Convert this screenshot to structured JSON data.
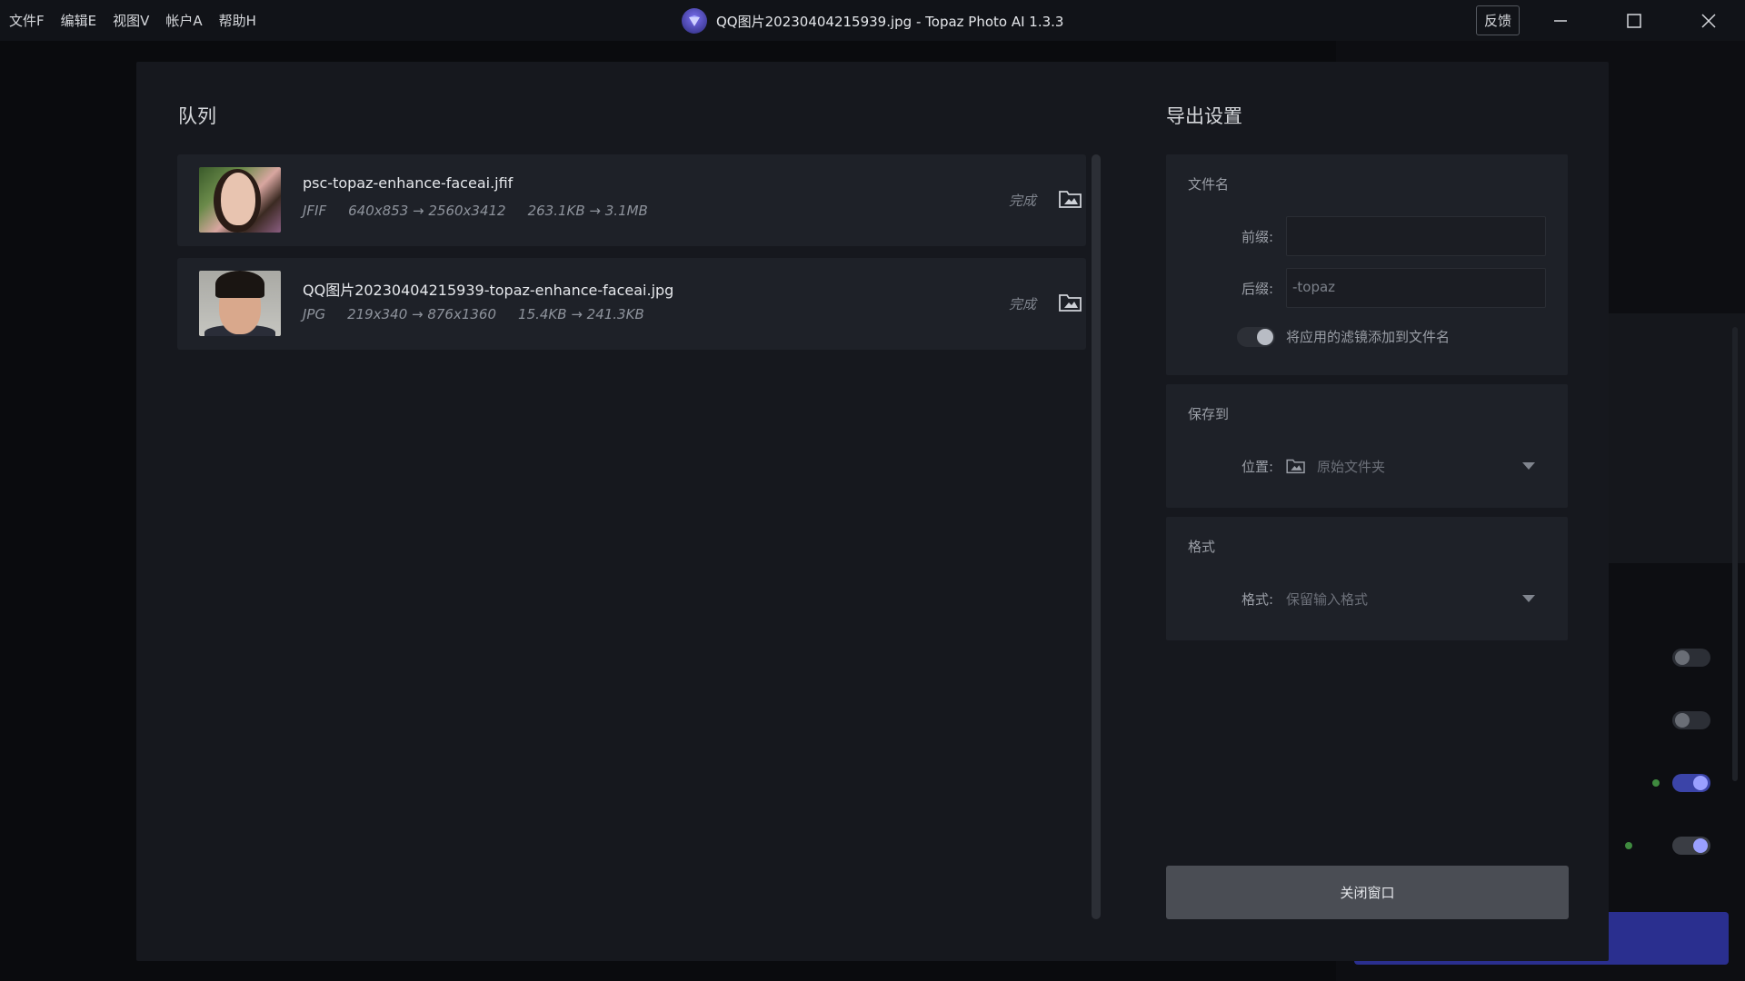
{
  "menu": {
    "items": [
      "文件F",
      "编辑E",
      "视图V",
      "帐户A",
      "帮助H"
    ]
  },
  "window": {
    "title": "QQ图片20230404215939.jpg - Topaz Photo AI 1.3.3",
    "feedback_label": "反馈"
  },
  "queue": {
    "title": "队列",
    "items": [
      {
        "name": "psc-topaz-enhance-faceai.jfif",
        "format": "JFIF",
        "dimensions": "640x853 → 2560x3412",
        "size": "263.1KB → 3.1MB",
        "status": "完成"
      },
      {
        "name": "QQ图片20230404215939-topaz-enhance-faceai.jpg",
        "format": "JPG",
        "dimensions": "219x340 → 876x1360",
        "size": "15.4KB → 241.3KB",
        "status": "完成"
      }
    ]
  },
  "export": {
    "title": "导出设置",
    "filename": {
      "title": "文件名",
      "prefix_label": "前缀:",
      "prefix_placeholder": "",
      "suffix_label": "后缀:",
      "suffix_value": "-topaz",
      "add_filters_label": "将应用的滤镜添加到文件名",
      "add_filters_on": true
    },
    "save_to": {
      "title": "保存到",
      "location_label": "位置:",
      "location_value": "原始文件夹"
    },
    "format": {
      "title": "格式",
      "format_label": "格式:",
      "format_value": "保留输入格式"
    },
    "close_label": "关闭窗口"
  },
  "colors": {
    "accent": "#3b44a8",
    "background": "#16181e",
    "panel": "#1e2128"
  }
}
